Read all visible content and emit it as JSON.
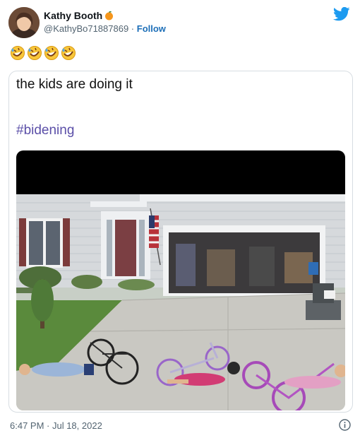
{
  "tweet": {
    "display_name": "Kathy Booth",
    "handle": "@KathyBo71887869",
    "separator": " · ",
    "follow_label": "Follow",
    "reaction_emojis": [
      "rolling-on-floor-laughing",
      "rolling-on-floor-laughing",
      "rolling-on-floor-laughing",
      "rolling-on-floor-laughing"
    ],
    "timestamp": "6:47 PM · Jul 18, 2022"
  },
  "card": {
    "text": "the kids are doing it",
    "hashtag": "#bidening"
  },
  "icons": {
    "brand": "twitter-bird-icon",
    "badge": "orange-emoji-badge",
    "info": "info-circle-icon"
  },
  "colors": {
    "twitter_blue": "#1d9bf0",
    "hashtag": "#5b4fa8",
    "follow": "#1d6fb8"
  }
}
